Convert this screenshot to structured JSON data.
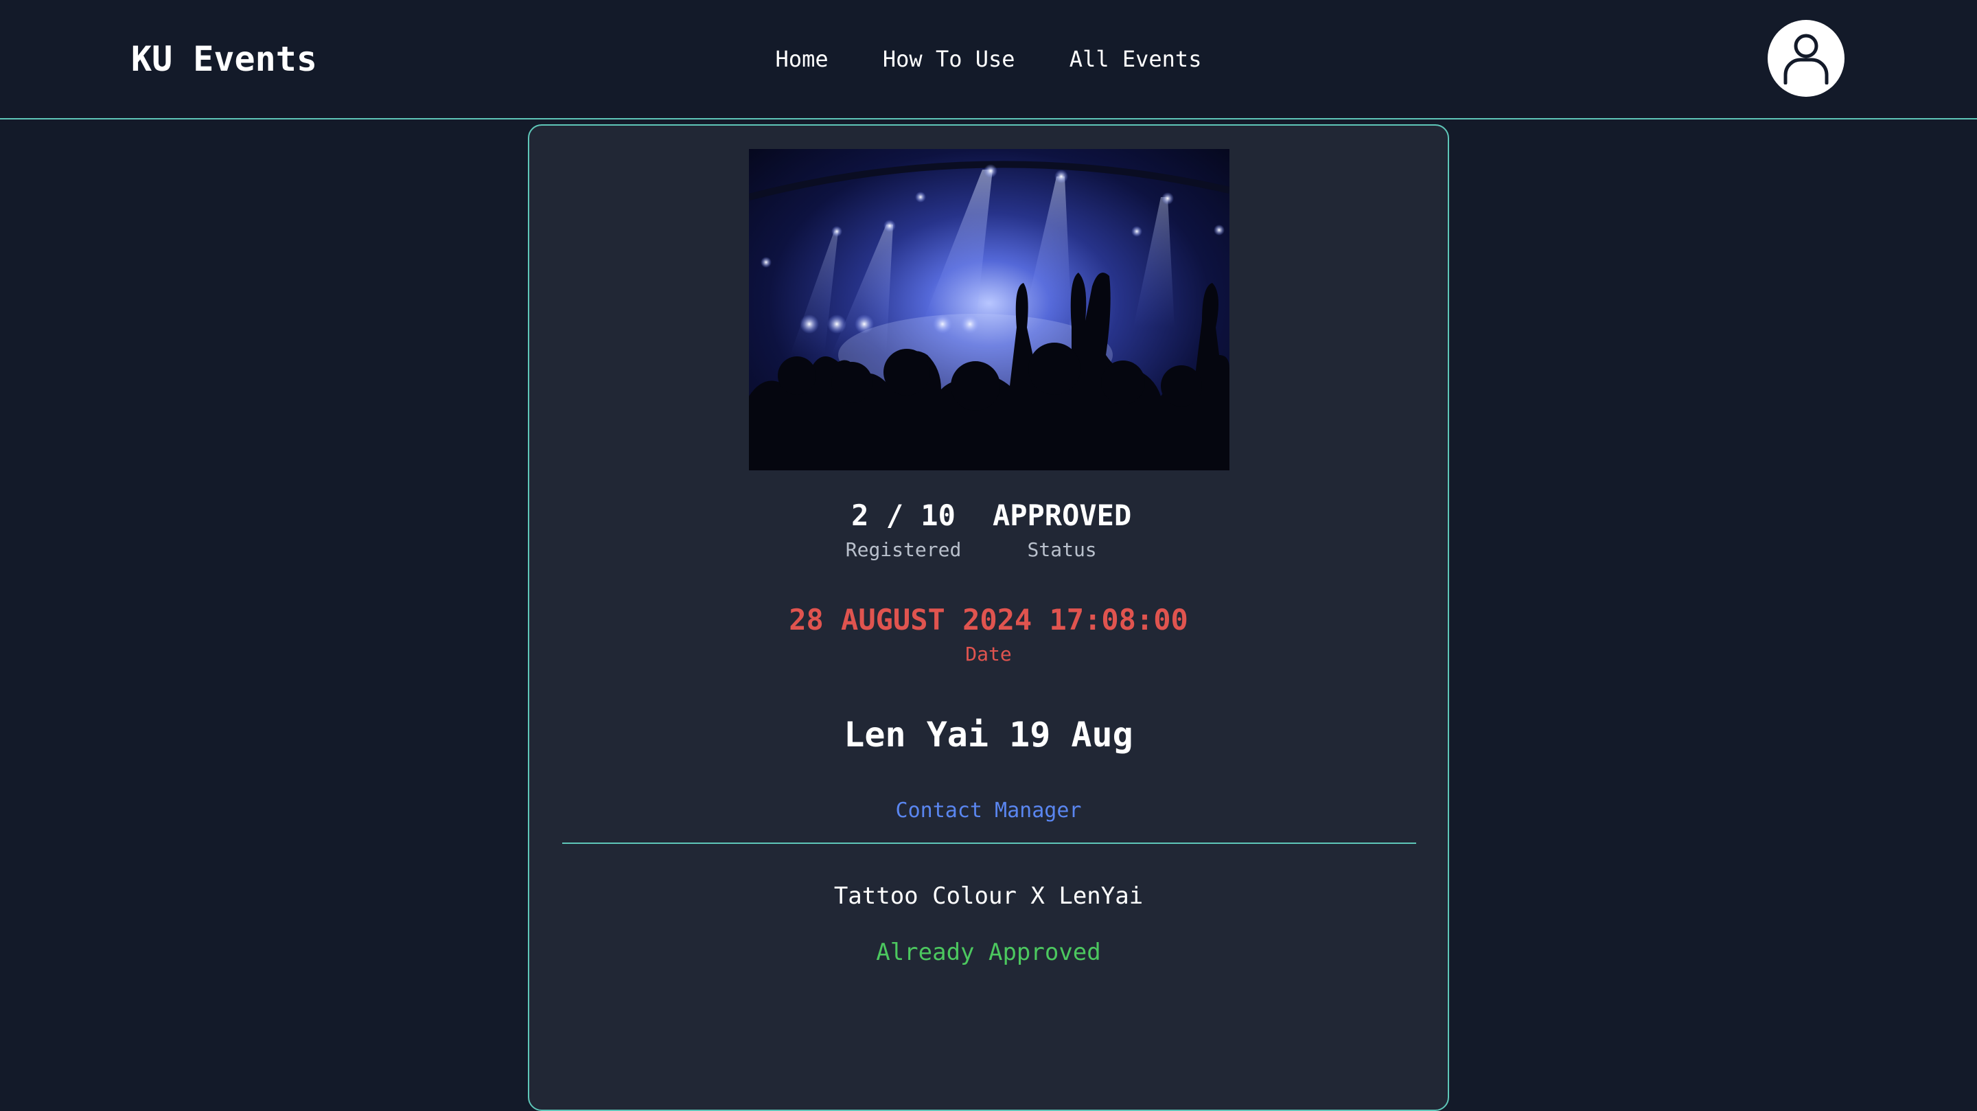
{
  "navbar": {
    "brand": "KU Events",
    "links": [
      "Home",
      "How To Use",
      "All Events"
    ],
    "profile_icon": "user-icon"
  },
  "event": {
    "image": "concert-crowd-image",
    "registered_value": "2 / 10",
    "registered_label": "Registered",
    "status_value": "APPROVED",
    "status_label": "Status",
    "date_value": "28 AUGUST 2024 17:08:00",
    "date_label": "Date",
    "title": "Len Yai 19 Aug",
    "contact_label": "Contact Manager",
    "organizer": "Tattoo Colour X LenYai",
    "approval_message": "Already Approved"
  },
  "colors": {
    "background": "#131a29",
    "card": "#212735",
    "accent_border": "#5fc7b9",
    "date_red": "#e0544f",
    "link_blue": "#5a86f0",
    "approved_green": "#4cc85f"
  }
}
